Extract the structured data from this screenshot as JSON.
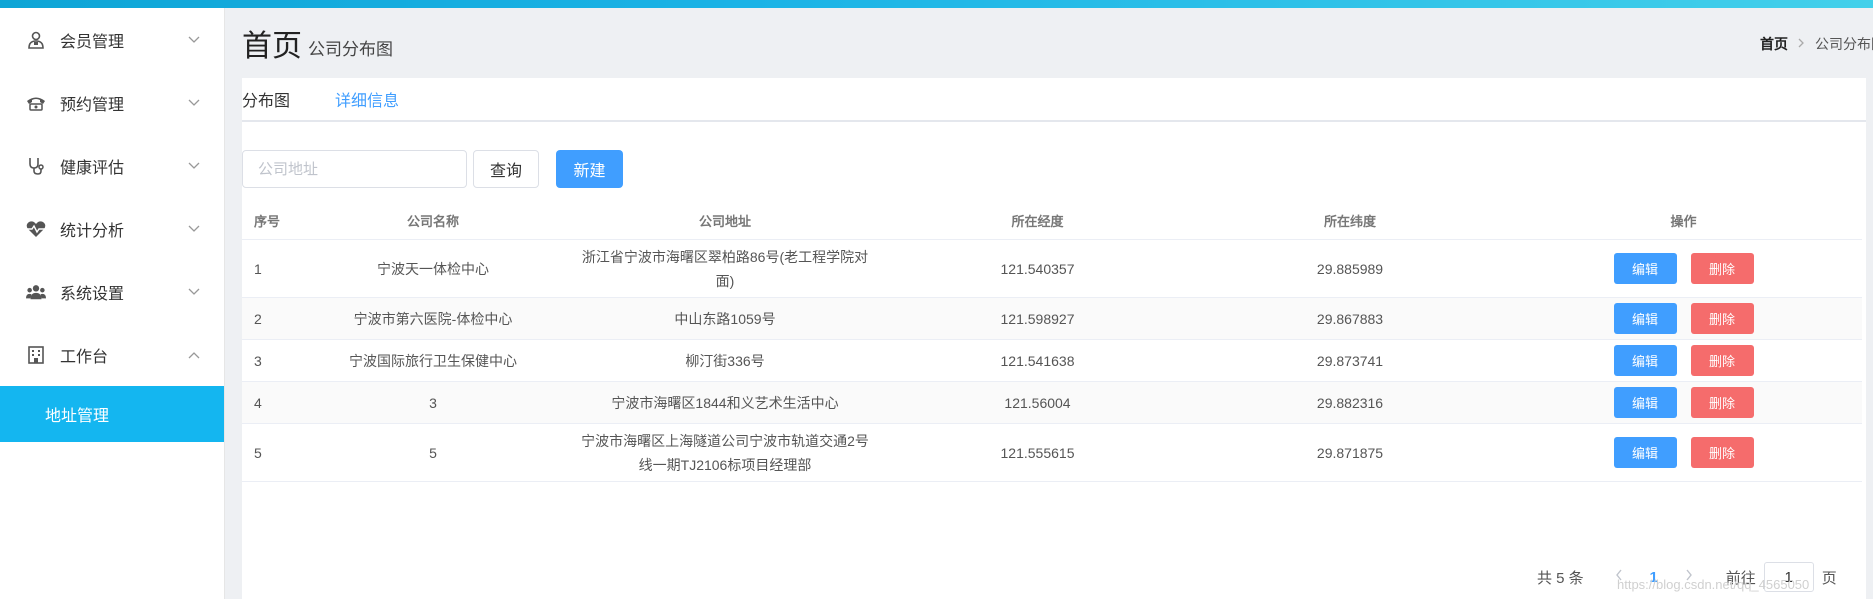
{
  "sidebar": {
    "items": [
      {
        "label": "会员管理",
        "icon": "user-icon",
        "arrow": "chevron-down-icon"
      },
      {
        "label": "预约管理",
        "icon": "phone-icon",
        "arrow": "chevron-down-icon"
      },
      {
        "label": "健康评估",
        "icon": "stethoscope-icon",
        "arrow": "chevron-down-icon"
      },
      {
        "label": "统计分析",
        "icon": "heartbeat-icon",
        "arrow": "chevron-down-icon"
      },
      {
        "label": "系统设置",
        "icon": "users-icon",
        "arrow": "chevron-down-icon"
      },
      {
        "label": "工作台",
        "icon": "building-icon",
        "arrow": "chevron-up-icon"
      }
    ],
    "active_subitem": "地址管理"
  },
  "header": {
    "title": "首页",
    "subtitle": "公司分布图"
  },
  "breadcrumb": {
    "home": "首页",
    "current": "公司分布图"
  },
  "tabs": [
    {
      "label": "分布图",
      "active": false
    },
    {
      "label": "详细信息",
      "active": true
    }
  ],
  "toolbar": {
    "search_placeholder": "公司地址",
    "query_label": "查询",
    "new_label": "新建"
  },
  "table": {
    "headers": {
      "idx": "序号",
      "name": "公司名称",
      "address": "公司地址",
      "lng": "所在经度",
      "lat": "所在纬度",
      "op": "操作"
    },
    "rows": [
      {
        "idx": "1",
        "name": "宁波天一体检中心",
        "address": "浙江省宁波市海曙区翠柏路86号(老工程学院对面)",
        "lng": "121.540357",
        "lat": "29.885989"
      },
      {
        "idx": "2",
        "name": "宁波市第六医院-体检中心",
        "address": "中山东路1059号",
        "lng": "121.598927",
        "lat": "29.867883"
      },
      {
        "idx": "3",
        "name": "宁波国际旅行卫生保健中心",
        "address": "柳汀街336号",
        "lng": "121.541638",
        "lat": "29.873741"
      },
      {
        "idx": "4",
        "name": "3",
        "address": "宁波市海曙区1844和义艺术生活中心",
        "lng": "121.56004",
        "lat": "29.882316"
      },
      {
        "idx": "5",
        "name": "5",
        "address": "宁波市海曙区上海隧道公司宁波市轨道交通2号线一期TJ2106标项目经理部",
        "lng": "121.555615",
        "lat": "29.871875"
      }
    ],
    "edit_label": "编辑",
    "delete_label": "删除"
  },
  "pagination": {
    "total": "共 5 条",
    "current": "1",
    "goto": "前往",
    "page_input": "1",
    "page_unit": "页"
  },
  "watermark": "https://blog.csdn.net/qq_4565050",
  "colors": {
    "accent": "#409eff",
    "danger": "#f56c6c",
    "sidebar_active": "#14b6f0"
  }
}
